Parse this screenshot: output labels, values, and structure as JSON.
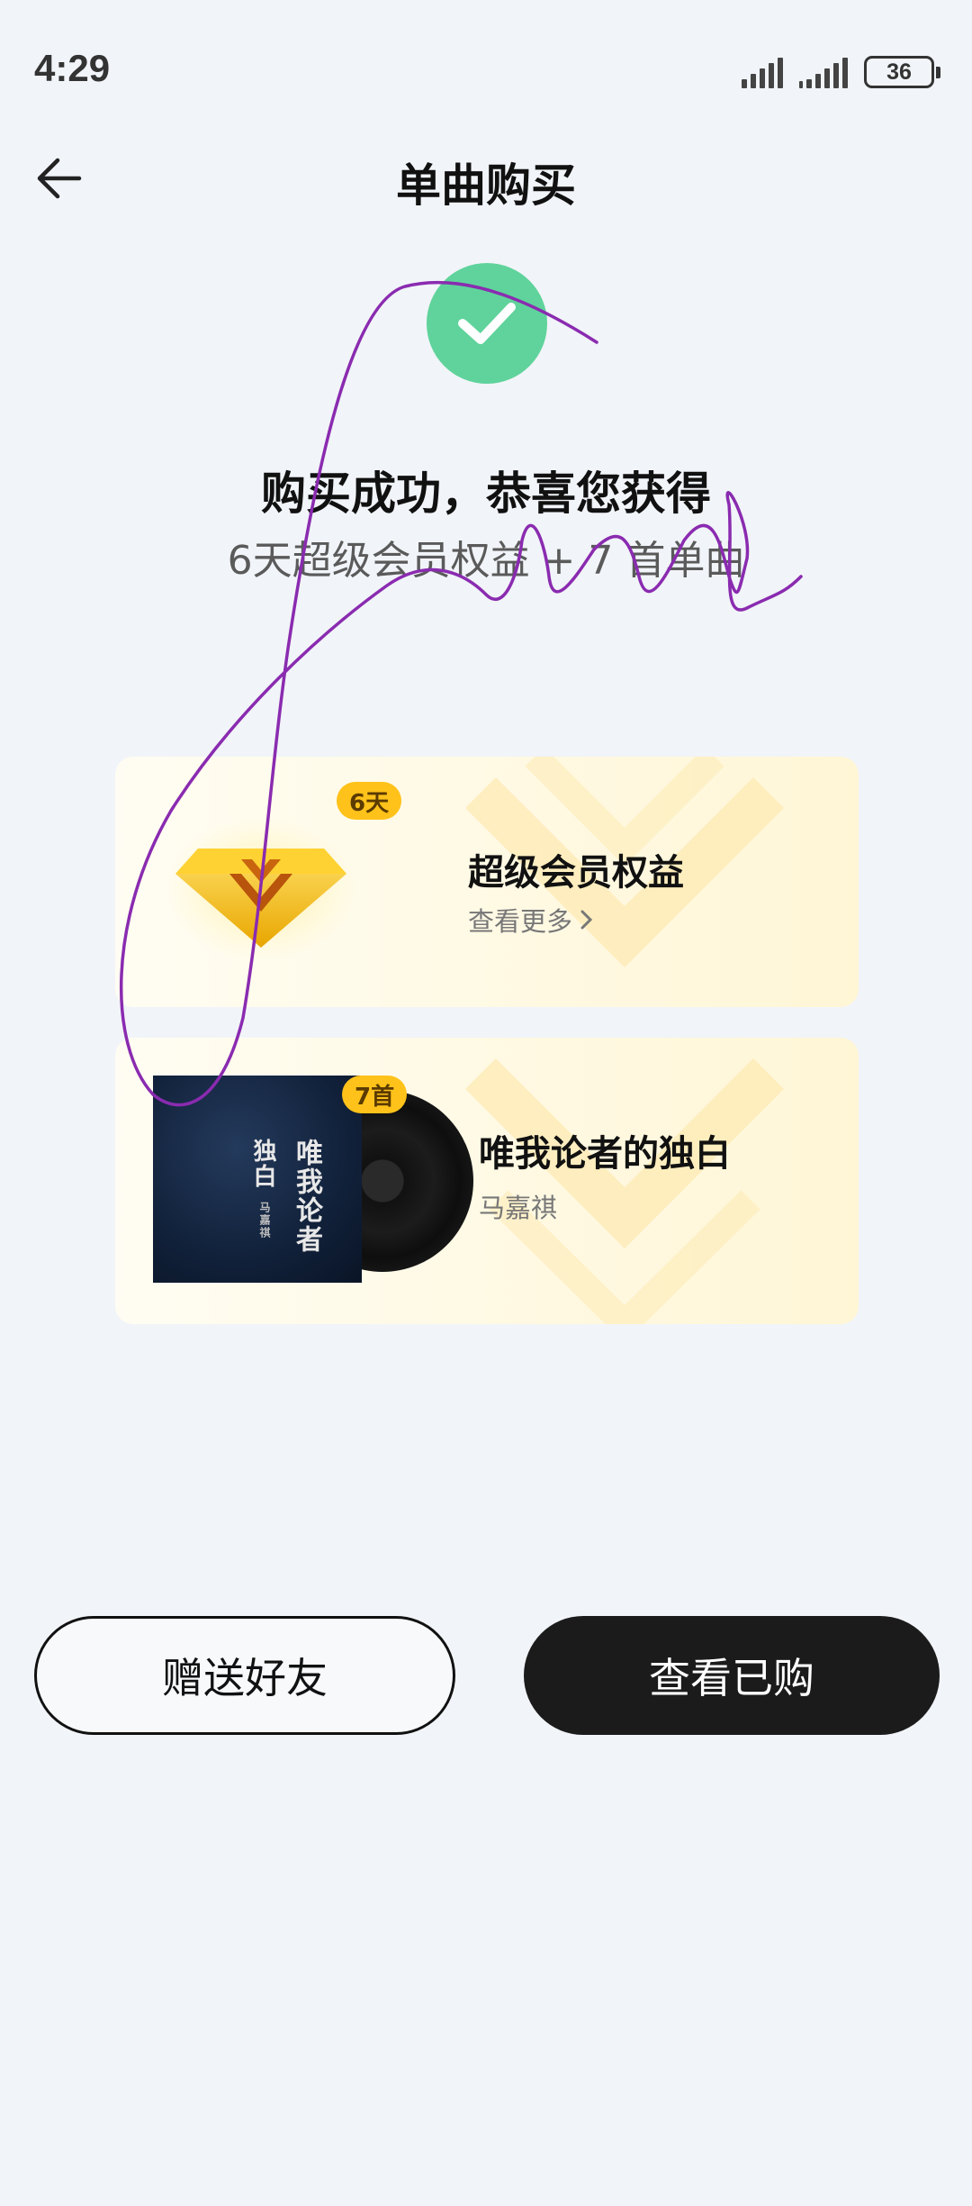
{
  "status_bar": {
    "time": "4:29",
    "battery": "36"
  },
  "header": {
    "title": "单曲购买",
    "back_icon": "arrow-left-icon"
  },
  "success": {
    "icon": "check-circle-icon",
    "title": "购买成功，恭喜您获得",
    "subtitle": "6天超级会员权益 + 7 首单曲"
  },
  "cards": [
    {
      "badge": "6天",
      "title": "超级会员权益",
      "link": "查看更多",
      "icon": "diamond-icon"
    },
    {
      "badge": "7首",
      "title": "唯我论者的独白",
      "artist": "马嘉祺",
      "icon": "album-cover"
    }
  ],
  "album_art": {
    "title": "唯我论者",
    "title2": "独白",
    "artist": "马嘉祺"
  },
  "buttons": {
    "gift": "赠送好友",
    "view": "查看已购"
  },
  "colors": {
    "background": "#f1f4f8",
    "success_green": "#5fd39b",
    "badge_yellow": "#ffc21a",
    "primary_button": "#1b1b1b"
  }
}
